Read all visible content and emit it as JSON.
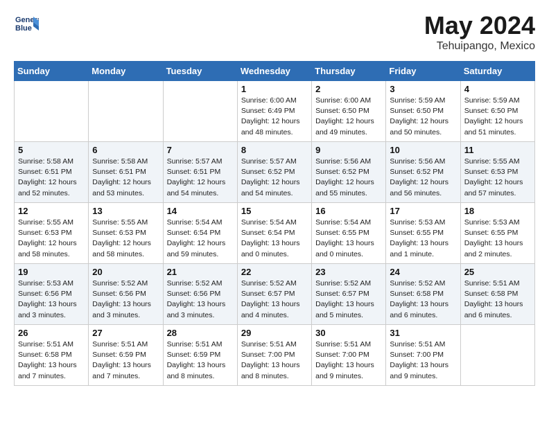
{
  "header": {
    "logo_line1": "General",
    "logo_line2": "Blue",
    "title": "May 2024",
    "subtitle": "Tehuipango, Mexico"
  },
  "days_of_week": [
    "Sunday",
    "Monday",
    "Tuesday",
    "Wednesday",
    "Thursday",
    "Friday",
    "Saturday"
  ],
  "weeks": [
    [
      {
        "day": "",
        "info": ""
      },
      {
        "day": "",
        "info": ""
      },
      {
        "day": "",
        "info": ""
      },
      {
        "day": "1",
        "info": "Sunrise: 6:00 AM\nSunset: 6:49 PM\nDaylight: 12 hours\nand 48 minutes."
      },
      {
        "day": "2",
        "info": "Sunrise: 6:00 AM\nSunset: 6:50 PM\nDaylight: 12 hours\nand 49 minutes."
      },
      {
        "day": "3",
        "info": "Sunrise: 5:59 AM\nSunset: 6:50 PM\nDaylight: 12 hours\nand 50 minutes."
      },
      {
        "day": "4",
        "info": "Sunrise: 5:59 AM\nSunset: 6:50 PM\nDaylight: 12 hours\nand 51 minutes."
      }
    ],
    [
      {
        "day": "5",
        "info": "Sunrise: 5:58 AM\nSunset: 6:51 PM\nDaylight: 12 hours\nand 52 minutes."
      },
      {
        "day": "6",
        "info": "Sunrise: 5:58 AM\nSunset: 6:51 PM\nDaylight: 12 hours\nand 53 minutes."
      },
      {
        "day": "7",
        "info": "Sunrise: 5:57 AM\nSunset: 6:51 PM\nDaylight: 12 hours\nand 54 minutes."
      },
      {
        "day": "8",
        "info": "Sunrise: 5:57 AM\nSunset: 6:52 PM\nDaylight: 12 hours\nand 54 minutes."
      },
      {
        "day": "9",
        "info": "Sunrise: 5:56 AM\nSunset: 6:52 PM\nDaylight: 12 hours\nand 55 minutes."
      },
      {
        "day": "10",
        "info": "Sunrise: 5:56 AM\nSunset: 6:52 PM\nDaylight: 12 hours\nand 56 minutes."
      },
      {
        "day": "11",
        "info": "Sunrise: 5:55 AM\nSunset: 6:53 PM\nDaylight: 12 hours\nand 57 minutes."
      }
    ],
    [
      {
        "day": "12",
        "info": "Sunrise: 5:55 AM\nSunset: 6:53 PM\nDaylight: 12 hours\nand 58 minutes."
      },
      {
        "day": "13",
        "info": "Sunrise: 5:55 AM\nSunset: 6:53 PM\nDaylight: 12 hours\nand 58 minutes."
      },
      {
        "day": "14",
        "info": "Sunrise: 5:54 AM\nSunset: 6:54 PM\nDaylight: 12 hours\nand 59 minutes."
      },
      {
        "day": "15",
        "info": "Sunrise: 5:54 AM\nSunset: 6:54 PM\nDaylight: 13 hours\nand 0 minutes."
      },
      {
        "day": "16",
        "info": "Sunrise: 5:54 AM\nSunset: 6:55 PM\nDaylight: 13 hours\nand 0 minutes."
      },
      {
        "day": "17",
        "info": "Sunrise: 5:53 AM\nSunset: 6:55 PM\nDaylight: 13 hours\nand 1 minute."
      },
      {
        "day": "18",
        "info": "Sunrise: 5:53 AM\nSunset: 6:55 PM\nDaylight: 13 hours\nand 2 minutes."
      }
    ],
    [
      {
        "day": "19",
        "info": "Sunrise: 5:53 AM\nSunset: 6:56 PM\nDaylight: 13 hours\nand 3 minutes."
      },
      {
        "day": "20",
        "info": "Sunrise: 5:52 AM\nSunset: 6:56 PM\nDaylight: 13 hours\nand 3 minutes."
      },
      {
        "day": "21",
        "info": "Sunrise: 5:52 AM\nSunset: 6:56 PM\nDaylight: 13 hours\nand 3 minutes."
      },
      {
        "day": "22",
        "info": "Sunrise: 5:52 AM\nSunset: 6:57 PM\nDaylight: 13 hours\nand 4 minutes."
      },
      {
        "day": "23",
        "info": "Sunrise: 5:52 AM\nSunset: 6:57 PM\nDaylight: 13 hours\nand 5 minutes."
      },
      {
        "day": "24",
        "info": "Sunrise: 5:52 AM\nSunset: 6:58 PM\nDaylight: 13 hours\nand 6 minutes."
      },
      {
        "day": "25",
        "info": "Sunrise: 5:51 AM\nSunset: 6:58 PM\nDaylight: 13 hours\nand 6 minutes."
      }
    ],
    [
      {
        "day": "26",
        "info": "Sunrise: 5:51 AM\nSunset: 6:58 PM\nDaylight: 13 hours\nand 7 minutes."
      },
      {
        "day": "27",
        "info": "Sunrise: 5:51 AM\nSunset: 6:59 PM\nDaylight: 13 hours\nand 7 minutes."
      },
      {
        "day": "28",
        "info": "Sunrise: 5:51 AM\nSunset: 6:59 PM\nDaylight: 13 hours\nand 8 minutes."
      },
      {
        "day": "29",
        "info": "Sunrise: 5:51 AM\nSunset: 7:00 PM\nDaylight: 13 hours\nand 8 minutes."
      },
      {
        "day": "30",
        "info": "Sunrise: 5:51 AM\nSunset: 7:00 PM\nDaylight: 13 hours\nand 9 minutes."
      },
      {
        "day": "31",
        "info": "Sunrise: 5:51 AM\nSunset: 7:00 PM\nDaylight: 13 hours\nand 9 minutes."
      },
      {
        "day": "",
        "info": ""
      }
    ]
  ]
}
